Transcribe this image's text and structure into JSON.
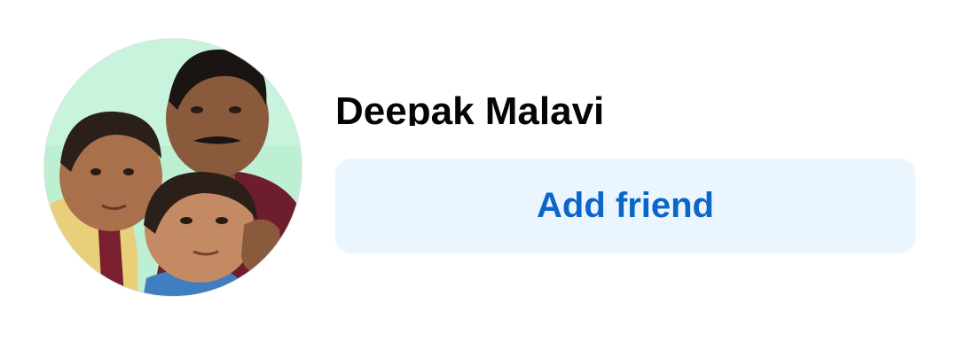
{
  "profile": {
    "name": "Deepak Malavi",
    "avatar_icon": "profile-photo"
  },
  "actions": {
    "add_friend_label": "Add friend"
  },
  "colors": {
    "button_background": "#ebf5fe",
    "button_text": "#0a66c8",
    "name_text": "#050505",
    "page_background": "#ffffff"
  }
}
